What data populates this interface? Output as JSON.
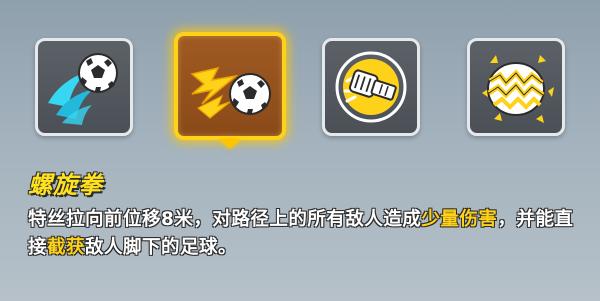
{
  "skills": [
    {
      "icon": "spinning-ball-icon",
      "selected": false
    },
    {
      "icon": "lightning-ball-icon",
      "selected": true
    },
    {
      "icon": "fist-punch-icon",
      "selected": false
    },
    {
      "icon": "shattered-shield-icon",
      "selected": false
    }
  ],
  "selected_skill": {
    "name": "螺旋拳",
    "description": {
      "part1": "特丝拉向前位移8米，对路径上的所有敌人造成",
      "highlight1": "少量伤害",
      "part2": "，并能直接",
      "highlight2": "截获",
      "part3": "敌人脚下的足球。"
    }
  },
  "colors": {
    "highlight": "#ffd21a",
    "selected_border": "#ffd21a",
    "selected_bg": "#9a5520",
    "tile_bg": "#52585e",
    "accent_cyan": "#37d6f2"
  }
}
